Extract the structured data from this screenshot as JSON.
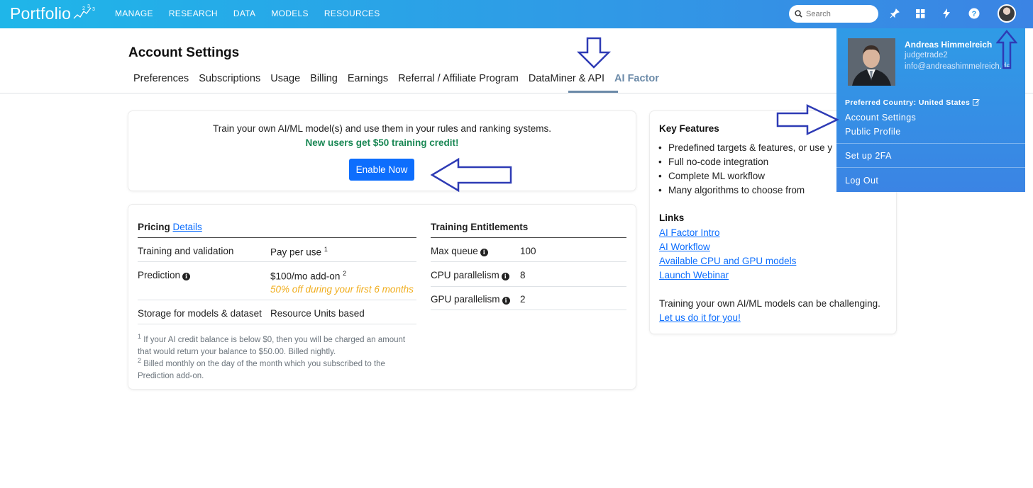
{
  "topnav": {
    "brand": "Portfolio",
    "menu": [
      "MANAGE",
      "RESEARCH",
      "DATA",
      "MODELS",
      "RESOURCES"
    ],
    "search_placeholder": "Search",
    "icons": [
      "search-icon",
      "pin-icon",
      "grid-icon",
      "lightning-icon",
      "help-icon",
      "avatar"
    ]
  },
  "page": {
    "title": "Account Settings",
    "tabs": [
      "Preferences",
      "Subscriptions",
      "Usage",
      "Billing",
      "Earnings",
      "Referral / Affiliate Program",
      "DataMiner & API",
      "AI Factor"
    ],
    "active_tab": "AI Factor"
  },
  "promo": {
    "line1": "Train your own AI/ML model(s) and use them in your rules and ranking systems.",
    "line2": "New users get $50 training credit!",
    "button": "Enable Now"
  },
  "pricing": {
    "heading": "Pricing",
    "details_link": "Details",
    "rows": [
      {
        "label": "Training and validation",
        "value": "Pay per use",
        "sup": "1",
        "note": "",
        "info": false
      },
      {
        "label": "Prediction",
        "value": "$100/mo add-on",
        "sup": "2",
        "note": "50% off during your first 6 months",
        "info": true
      },
      {
        "label": "Storage for models & dataset",
        "value": "Resource Units based",
        "sup": "",
        "note": "",
        "info": false
      }
    ],
    "footnotes": [
      {
        "num": "1",
        "text": "If your AI credit balance is below $0, then you will be charged an amount that would return your balance to $50.00. Billed nightly."
      },
      {
        "num": "2",
        "text": "Billed monthly on the day of the month which you subscribed to the Prediction add-on."
      }
    ]
  },
  "entitlements": {
    "heading": "Training Entitlements",
    "rows": [
      {
        "label": "Max queue",
        "value": "100"
      },
      {
        "label": "CPU parallelism",
        "value": "8"
      },
      {
        "label": "GPU parallelism",
        "value": "2"
      }
    ]
  },
  "key_features": {
    "heading": "Key Features",
    "items": [
      "Predefined targets & features, or use y",
      "Full no-code integration",
      "Complete ML workflow",
      "Many algorithms to choose from"
    ],
    "links_heading": "Links",
    "links": [
      "AI Factor Intro",
      "AI Workflow",
      "Available CPU and GPU models",
      "Launch Webinar"
    ],
    "closing": "Training your own AI/ML models can be challenging.",
    "closing_link": "Let us do it for you!"
  },
  "dropdown": {
    "name": "Andreas Himmelreich",
    "username": "judgetrade2",
    "email": "info@andreashimmelreich.de",
    "country_label": "Preferred Country:",
    "country": "United States",
    "items": [
      "Account Settings",
      "Public Profile",
      "Set up 2FA",
      "Log Out"
    ]
  },
  "colors": {
    "nav_start": "#1fb6e9",
    "nav_end": "#3b84e4",
    "primary_button": "#0d6efd",
    "credit_green": "#198754",
    "discount_orange": "#f0ad1d",
    "active_tab": "#6b8aa8",
    "annotation_arrow": "#2e3bb5"
  }
}
